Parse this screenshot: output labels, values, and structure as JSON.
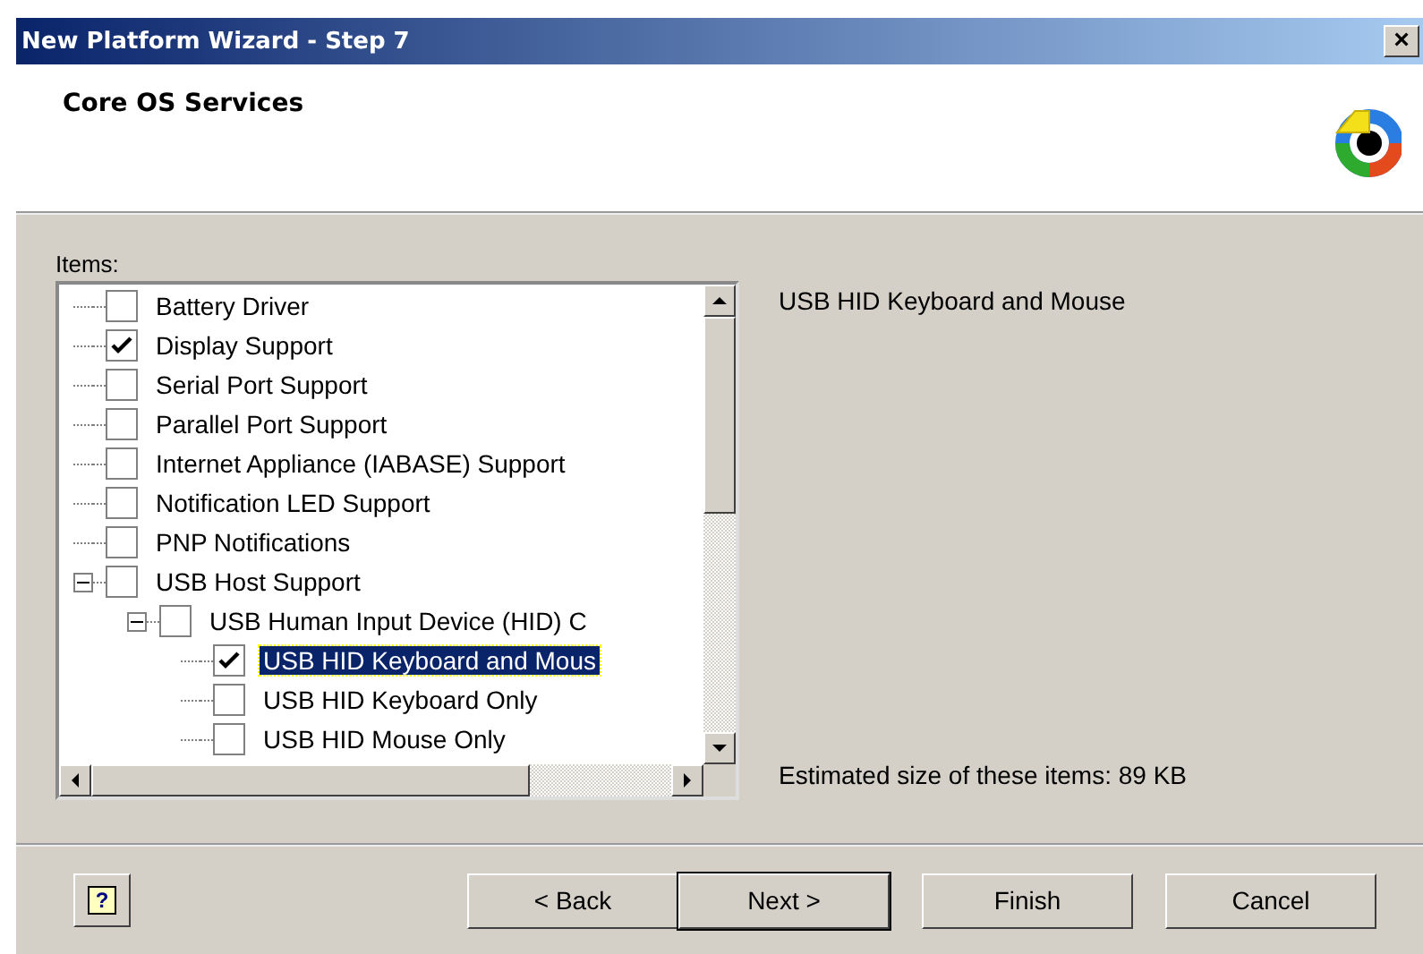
{
  "window": {
    "title": "New Platform Wizard - Step 7",
    "close": "×"
  },
  "header": {
    "title": "Core OS Services"
  },
  "items_label": "Items:",
  "tree": [
    {
      "label": "Battery Driver",
      "checked": false,
      "selected": false
    },
    {
      "label": "Display Support",
      "checked": true,
      "selected": false
    },
    {
      "label": "Serial Port Support",
      "checked": false,
      "selected": false
    },
    {
      "label": "Parallel Port Support",
      "checked": false,
      "selected": false
    },
    {
      "label": "Internet Appliance (IABASE) Support",
      "checked": false,
      "selected": false
    },
    {
      "label": "Notification LED Support",
      "checked": false,
      "selected": false
    },
    {
      "label": "PNP Notifications",
      "checked": false,
      "selected": false
    },
    {
      "label": "USB Host Support",
      "checked": false,
      "selected": false,
      "expanded": true,
      "children": [
        {
          "label": "USB Human Input Device (HID) C",
          "checked": false,
          "selected": false,
          "expanded": true,
          "children": [
            {
              "label": "USB HID Keyboard and Mous",
              "checked": true,
              "selected": true
            },
            {
              "label": "USB HID Keyboard Only",
              "checked": false,
              "selected": false
            },
            {
              "label": "USB HID Mouse Only",
              "checked": false,
              "selected": false
            }
          ]
        }
      ]
    }
  ],
  "description": "USB HID Keyboard and Mouse",
  "estimated_size": "Estimated size of these items: 89 KB",
  "help_button": "?",
  "buttons": [
    {
      "label": "< Back",
      "default": false
    },
    {
      "label": "Next >",
      "default": true
    },
    {
      "label": "Finish",
      "default": false
    },
    {
      "label": "Cancel",
      "default": false
    }
  ]
}
